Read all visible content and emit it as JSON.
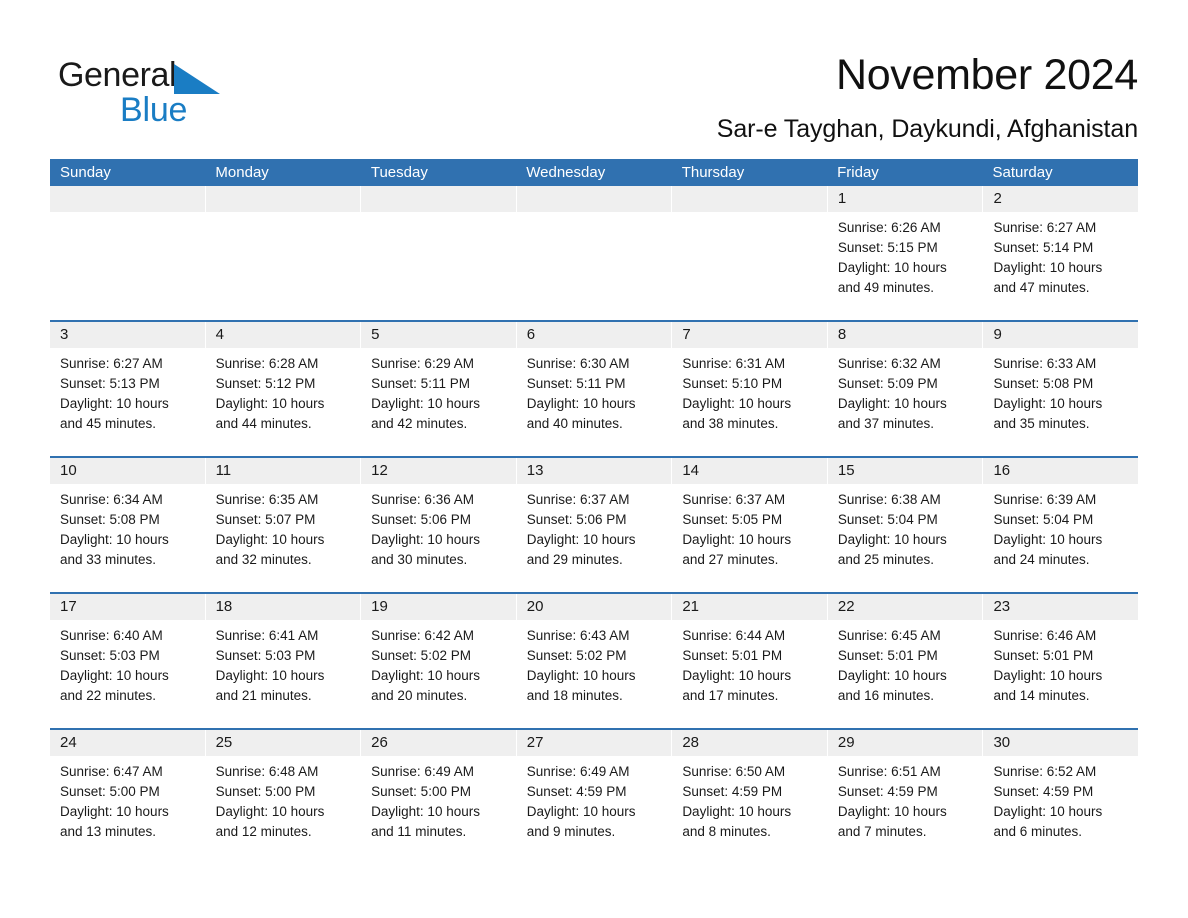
{
  "brand": {
    "name_part1": "General",
    "name_part2": "Blue",
    "triangle_icon": "triangle-logo-icon",
    "accent_color": "#1a7dc4"
  },
  "header": {
    "month_title": "November 2024",
    "location": "Sar-e Tayghan, Daykundi, Afghanistan"
  },
  "calendar": {
    "header_color": "#3071b0",
    "daynum_band_color": "#efefef",
    "day_names": [
      "Sunday",
      "Monday",
      "Tuesday",
      "Wednesday",
      "Thursday",
      "Friday",
      "Saturday"
    ],
    "weeks": [
      [
        {
          "day": "",
          "lines": []
        },
        {
          "day": "",
          "lines": []
        },
        {
          "day": "",
          "lines": []
        },
        {
          "day": "",
          "lines": []
        },
        {
          "day": "",
          "lines": []
        },
        {
          "day": "1",
          "lines": [
            "Sunrise: 6:26 AM",
            "Sunset: 5:15 PM",
            "Daylight: 10 hours",
            "and 49 minutes."
          ]
        },
        {
          "day": "2",
          "lines": [
            "Sunrise: 6:27 AM",
            "Sunset: 5:14 PM",
            "Daylight: 10 hours",
            "and 47 minutes."
          ]
        }
      ],
      [
        {
          "day": "3",
          "lines": [
            "Sunrise: 6:27 AM",
            "Sunset: 5:13 PM",
            "Daylight: 10 hours",
            "and 45 minutes."
          ]
        },
        {
          "day": "4",
          "lines": [
            "Sunrise: 6:28 AM",
            "Sunset: 5:12 PM",
            "Daylight: 10 hours",
            "and 44 minutes."
          ]
        },
        {
          "day": "5",
          "lines": [
            "Sunrise: 6:29 AM",
            "Sunset: 5:11 PM",
            "Daylight: 10 hours",
            "and 42 minutes."
          ]
        },
        {
          "day": "6",
          "lines": [
            "Sunrise: 6:30 AM",
            "Sunset: 5:11 PM",
            "Daylight: 10 hours",
            "and 40 minutes."
          ]
        },
        {
          "day": "7",
          "lines": [
            "Sunrise: 6:31 AM",
            "Sunset: 5:10 PM",
            "Daylight: 10 hours",
            "and 38 minutes."
          ]
        },
        {
          "day": "8",
          "lines": [
            "Sunrise: 6:32 AM",
            "Sunset: 5:09 PM",
            "Daylight: 10 hours",
            "and 37 minutes."
          ]
        },
        {
          "day": "9",
          "lines": [
            "Sunrise: 6:33 AM",
            "Sunset: 5:08 PM",
            "Daylight: 10 hours",
            "and 35 minutes."
          ]
        }
      ],
      [
        {
          "day": "10",
          "lines": [
            "Sunrise: 6:34 AM",
            "Sunset: 5:08 PM",
            "Daylight: 10 hours",
            "and 33 minutes."
          ]
        },
        {
          "day": "11",
          "lines": [
            "Sunrise: 6:35 AM",
            "Sunset: 5:07 PM",
            "Daylight: 10 hours",
            "and 32 minutes."
          ]
        },
        {
          "day": "12",
          "lines": [
            "Sunrise: 6:36 AM",
            "Sunset: 5:06 PM",
            "Daylight: 10 hours",
            "and 30 minutes."
          ]
        },
        {
          "day": "13",
          "lines": [
            "Sunrise: 6:37 AM",
            "Sunset: 5:06 PM",
            "Daylight: 10 hours",
            "and 29 minutes."
          ]
        },
        {
          "day": "14",
          "lines": [
            "Sunrise: 6:37 AM",
            "Sunset: 5:05 PM",
            "Daylight: 10 hours",
            "and 27 minutes."
          ]
        },
        {
          "day": "15",
          "lines": [
            "Sunrise: 6:38 AM",
            "Sunset: 5:04 PM",
            "Daylight: 10 hours",
            "and 25 minutes."
          ]
        },
        {
          "day": "16",
          "lines": [
            "Sunrise: 6:39 AM",
            "Sunset: 5:04 PM",
            "Daylight: 10 hours",
            "and 24 minutes."
          ]
        }
      ],
      [
        {
          "day": "17",
          "lines": [
            "Sunrise: 6:40 AM",
            "Sunset: 5:03 PM",
            "Daylight: 10 hours",
            "and 22 minutes."
          ]
        },
        {
          "day": "18",
          "lines": [
            "Sunrise: 6:41 AM",
            "Sunset: 5:03 PM",
            "Daylight: 10 hours",
            "and 21 minutes."
          ]
        },
        {
          "day": "19",
          "lines": [
            "Sunrise: 6:42 AM",
            "Sunset: 5:02 PM",
            "Daylight: 10 hours",
            "and 20 minutes."
          ]
        },
        {
          "day": "20",
          "lines": [
            "Sunrise: 6:43 AM",
            "Sunset: 5:02 PM",
            "Daylight: 10 hours",
            "and 18 minutes."
          ]
        },
        {
          "day": "21",
          "lines": [
            "Sunrise: 6:44 AM",
            "Sunset: 5:01 PM",
            "Daylight: 10 hours",
            "and 17 minutes."
          ]
        },
        {
          "day": "22",
          "lines": [
            "Sunrise: 6:45 AM",
            "Sunset: 5:01 PM",
            "Daylight: 10 hours",
            "and 16 minutes."
          ]
        },
        {
          "day": "23",
          "lines": [
            "Sunrise: 6:46 AM",
            "Sunset: 5:01 PM",
            "Daylight: 10 hours",
            "and 14 minutes."
          ]
        }
      ],
      [
        {
          "day": "24",
          "lines": [
            "Sunrise: 6:47 AM",
            "Sunset: 5:00 PM",
            "Daylight: 10 hours",
            "and 13 minutes."
          ]
        },
        {
          "day": "25",
          "lines": [
            "Sunrise: 6:48 AM",
            "Sunset: 5:00 PM",
            "Daylight: 10 hours",
            "and 12 minutes."
          ]
        },
        {
          "day": "26",
          "lines": [
            "Sunrise: 6:49 AM",
            "Sunset: 5:00 PM",
            "Daylight: 10 hours",
            "and 11 minutes."
          ]
        },
        {
          "day": "27",
          "lines": [
            "Sunrise: 6:49 AM",
            "Sunset: 4:59 PM",
            "Daylight: 10 hours",
            "and 9 minutes."
          ]
        },
        {
          "day": "28",
          "lines": [
            "Sunrise: 6:50 AM",
            "Sunset: 4:59 PM",
            "Daylight: 10 hours",
            "and 8 minutes."
          ]
        },
        {
          "day": "29",
          "lines": [
            "Sunrise: 6:51 AM",
            "Sunset: 4:59 PM",
            "Daylight: 10 hours",
            "and 7 minutes."
          ]
        },
        {
          "day": "30",
          "lines": [
            "Sunrise: 6:52 AM",
            "Sunset: 4:59 PM",
            "Daylight: 10 hours",
            "and 6 minutes."
          ]
        }
      ]
    ]
  }
}
